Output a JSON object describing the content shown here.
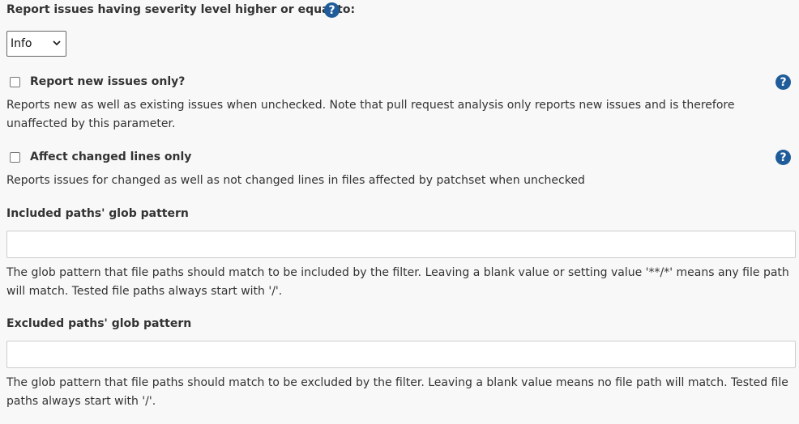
{
  "severity": {
    "label": "Report issues having severity level higher or equal to:",
    "help": "?",
    "selected": "Info"
  },
  "new_issues": {
    "label": "Report new issues only?",
    "help": "?",
    "checked": false,
    "description": "Reports new as well as existing issues when unchecked. Note that pull request analysis only reports new issues and is therefore unaffected by this parameter."
  },
  "changed_lines": {
    "label": "Affect changed lines only",
    "help": "?",
    "checked": false,
    "description": "Reports issues for changed as well as not changed lines in files affected by patchset when unchecked"
  },
  "included_paths": {
    "label": "Included paths' glob pattern",
    "value": "",
    "description": "The glob pattern that file paths should match to be included by the filter. Leaving a blank value or setting value '**/*' means any file path will match. Tested file paths always start with '/'."
  },
  "excluded_paths": {
    "label": "Excluded paths' glob pattern",
    "value": "",
    "description": "The glob pattern that file paths should match to be excluded by the filter. Leaving a blank value means no file path will match. Tested file paths always start with '/'."
  },
  "colors": {
    "help_icon": "#1f5c99",
    "background": "#f8f8f8"
  }
}
